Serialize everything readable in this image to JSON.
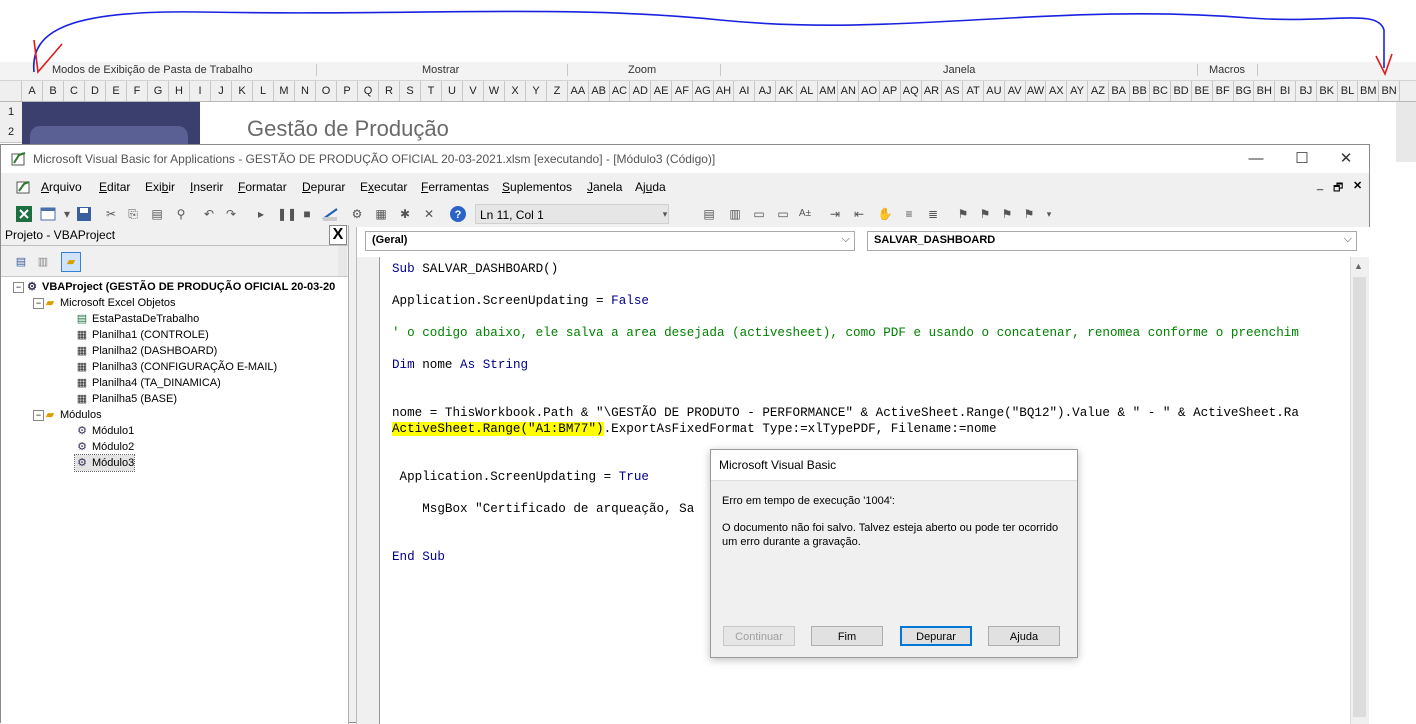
{
  "excel": {
    "ribbon_groups": [
      "Modos de Exibição de Pasta de Trabalho",
      "Mostrar",
      "Zoom",
      "Janela",
      "Macros"
    ],
    "columns": [
      "A",
      "B",
      "C",
      "D",
      "E",
      "F",
      "G",
      "H",
      "I",
      "J",
      "K",
      "L",
      "M",
      "N",
      "O",
      "P",
      "Q",
      "R",
      "S",
      "T",
      "U",
      "V",
      "W",
      "X",
      "Y",
      "Z",
      "AA",
      "AB",
      "AC",
      "AD",
      "AE",
      "AF",
      "AG",
      "AH",
      "AI",
      "AJ",
      "AK",
      "AL",
      "AM",
      "AN",
      "AO",
      "AP",
      "AQ",
      "AR",
      "AS",
      "AT",
      "AU",
      "AV",
      "AW",
      "AX",
      "AY",
      "AZ",
      "BA",
      "BB",
      "BC",
      "BD",
      "BE",
      "BF",
      "BG",
      "BH",
      "BI",
      "BJ",
      "BK",
      "BL",
      "BM",
      "BN"
    ],
    "rows": [
      "1",
      "2"
    ],
    "sheet_title": "Gestão de Produção"
  },
  "vbe": {
    "title": "Microsoft Visual Basic for Applications - GESTÃO DE PRODUÇÃO OFICIAL 20-03-2021.xlsm [executando] - [Módulo3 (Código)]",
    "window_buttons": {
      "minimize": "—",
      "maximize": "☐",
      "close": "✕"
    },
    "menu": [
      {
        "u": "A",
        "rest": "rquivo"
      },
      {
        "u": "E",
        "rest": "ditar"
      },
      {
        "pre": "Exi",
        "u": "b",
        "rest": "ir"
      },
      {
        "u": "I",
        "rest": "nserir"
      },
      {
        "u": "F",
        "rest": "ormatar"
      },
      {
        "u": "D",
        "rest": "epurar"
      },
      {
        "pre": "E",
        "u": "x",
        "rest": "ecutar"
      },
      {
        "u": "F",
        "rest": "erramentas"
      },
      {
        "u": "S",
        "rest": "uplementos"
      },
      {
        "u": "J",
        "rest": "anela"
      },
      {
        "pre": "Aj",
        "u": "u",
        "rest": "da"
      }
    ],
    "inner_window_buttons": {
      "minimize": "_",
      "restore": "🗗",
      "close": "✕"
    },
    "position": "Ln 11, Col 1",
    "project": {
      "title": "Projeto - VBAProject",
      "close": "X",
      "tree": [
        {
          "label": "VBAProject (GESTÃO DE PRODUÇÃO OFICIAL 20-03-20",
          "bold": true,
          "icon": "vbaproject-icon"
        },
        {
          "label": "Microsoft Excel Objetos",
          "icon": "folder-icon"
        },
        {
          "label": "EstaPastaDeTrabalho",
          "icon": "workbook-icon"
        },
        {
          "label": "Planilha1 (CONTROLE)",
          "icon": "worksheet-icon"
        },
        {
          "label": "Planilha2 (DASHBOARD)",
          "icon": "worksheet-icon"
        },
        {
          "label": "Planilha3 (CONFIGURAÇÃO E-MAIL)",
          "icon": "worksheet-icon"
        },
        {
          "label": "Planilha4 (TA_DINAMICA)",
          "icon": "worksheet-icon"
        },
        {
          "label": "Planilha5 (BASE)",
          "icon": "worksheet-icon"
        },
        {
          "label": "Módulos",
          "icon": "folder-icon"
        },
        {
          "label": "Módulo1",
          "icon": "module-icon"
        },
        {
          "label": "Módulo2",
          "icon": "module-icon"
        },
        {
          "label": "Módulo3",
          "icon": "module-icon"
        }
      ]
    },
    "code": {
      "object_combo": "(Geral)",
      "proc_combo": "SALVAR_DASHBOARD",
      "lines": {
        "l1_kw": "Sub",
        "l1_rest": " SALVAR_DASHBOARD()",
        "l2_a": "Application.ScreenUpdating = ",
        "l2_kw": "False",
        "l3": "' o codigo abaixo, ele salva a area desejada (activesheet), como PDF e usando o concatenar, renomea conforme o preenchim",
        "l4_kw1": "Dim",
        "l4_mid": " nome ",
        "l4_kw2": "As String",
        "l5": "nome = ThisWorkbook.Path & \"\\GESTÃO DE PRODUTO - PERFORMANCE\" & ActiveSheet.Range(\"BQ12\").Value & \" - \" & ActiveSheet.Ra",
        "l6_hl": "ActiveSheet.Range(\"A1:BM77\")",
        "l6_rest": ".ExportAsFixedFormat Type:=xlTypePDF, Filename:=nome",
        "l7_a": " Application.ScreenUpdating = ",
        "l7_kw": "True",
        "l8": "    MsgBox \"Certificado de arqueação, Sa",
        "l9": "End Sub"
      }
    },
    "dialog": {
      "title": "Microsoft Visual Basic",
      "error": "Erro em tempo de execução '1004':",
      "message": "O documento não foi salvo. Talvez esteja aberto ou pode ter ocorrido um erro durante a gravação.",
      "buttons": {
        "continue": "Continuar",
        "end": "Fim",
        "debug": "Depurar",
        "help": "Ajuda"
      }
    }
  },
  "colors": {
    "annotation": "#1a22e0",
    "annotation_arrow": "#e01a1a",
    "highlight": "#ffff00"
  }
}
